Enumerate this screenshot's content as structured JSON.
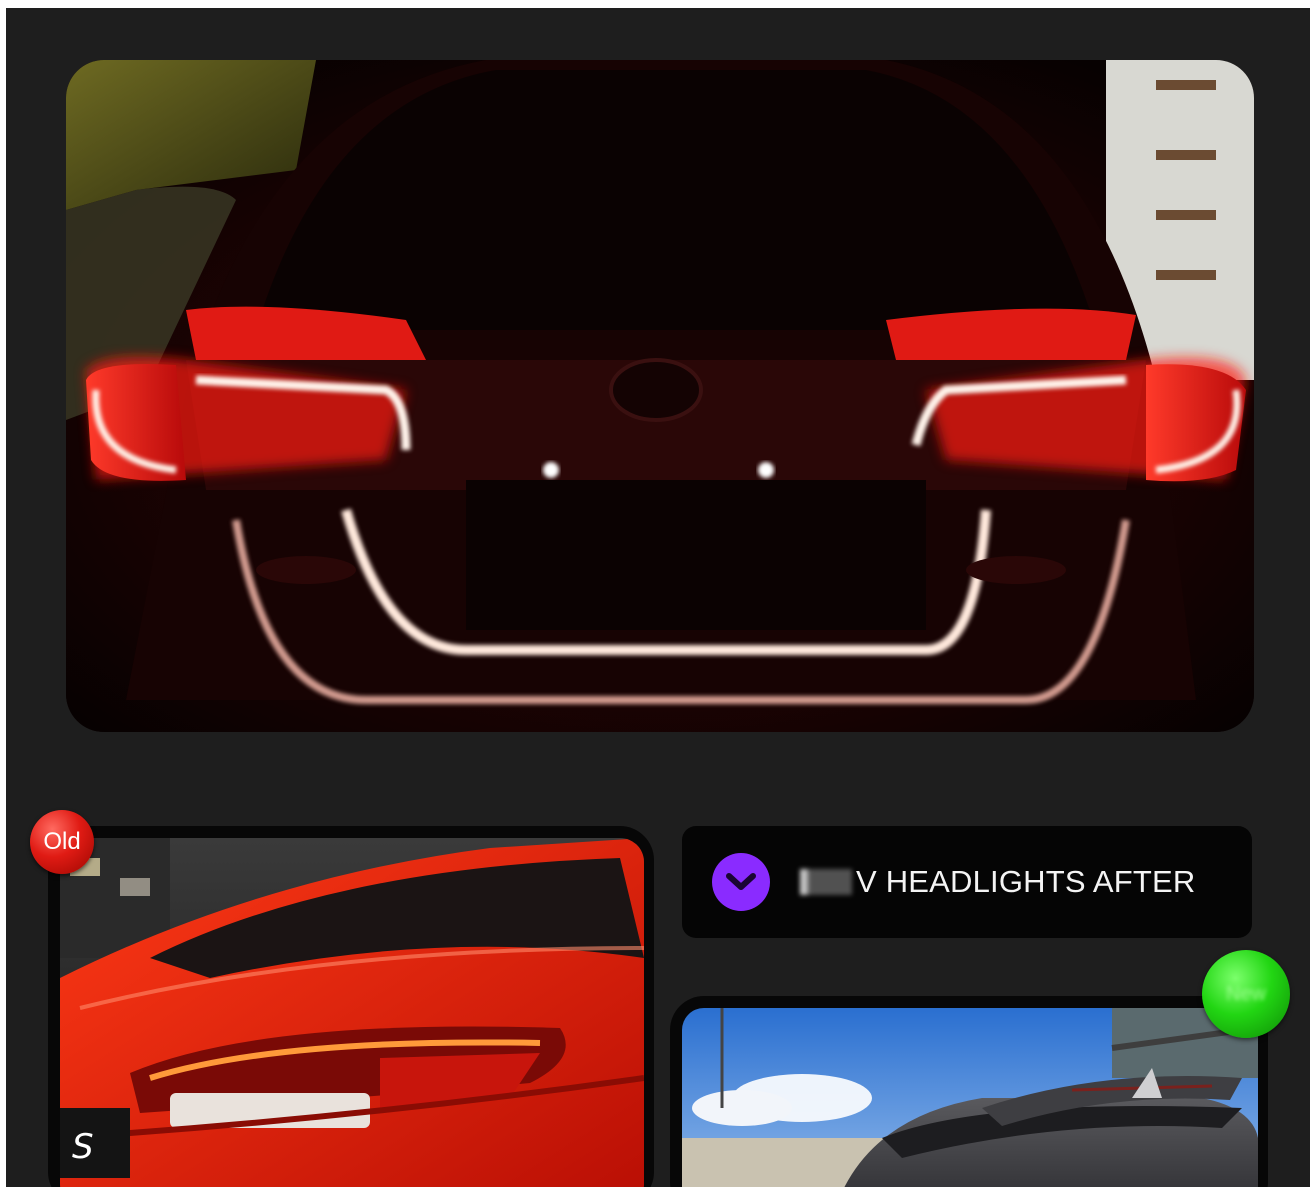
{
  "badges": {
    "old_label": "Old",
    "new_label": "New"
  },
  "info_bar": {
    "text": "V HEADLIGHTS AFTER",
    "icon": "chevron-down-icon",
    "icon_color": "#8a2bff"
  },
  "colors": {
    "panel_background": "#1e1e1e",
    "old_badge": "#e01b14",
    "new_badge": "#22d613"
  }
}
